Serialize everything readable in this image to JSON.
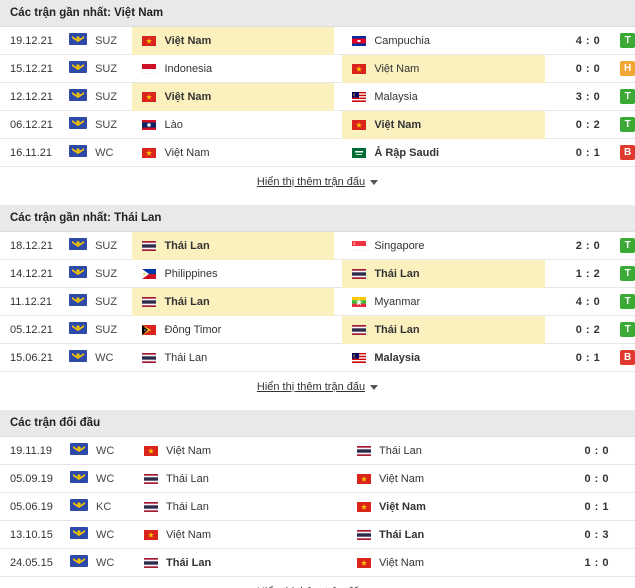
{
  "sections": [
    {
      "title": "Các trận gần nhất: Việt Nam",
      "more_label": "Hiển thị thêm trận đấu",
      "matches": [
        {
          "date": "19.12.21",
          "league": "SUZ",
          "home": {
            "name": "Việt Nam",
            "flag": "vietnam",
            "bold": true,
            "hl": true
          },
          "away": {
            "name": "Campuchia",
            "flag": "cambodia",
            "bold": false,
            "hl": false
          },
          "score": "4 : 0",
          "result": "T"
        },
        {
          "date": "15.12.21",
          "league": "SUZ",
          "home": {
            "name": "Indonesia",
            "flag": "indonesia",
            "bold": false,
            "hl": false
          },
          "away": {
            "name": "Việt Nam",
            "flag": "vietnam",
            "bold": false,
            "hl": true
          },
          "score": "0 : 0",
          "result": "H"
        },
        {
          "date": "12.12.21",
          "league": "SUZ",
          "home": {
            "name": "Việt Nam",
            "flag": "vietnam",
            "bold": true,
            "hl": true
          },
          "away": {
            "name": "Malaysia",
            "flag": "malaysia",
            "bold": false,
            "hl": false
          },
          "score": "3 : 0",
          "result": "T"
        },
        {
          "date": "06.12.21",
          "league": "SUZ",
          "home": {
            "name": "Lào",
            "flag": "laos",
            "bold": false,
            "hl": false
          },
          "away": {
            "name": "Việt Nam",
            "flag": "vietnam",
            "bold": true,
            "hl": true
          },
          "score": "0 : 2",
          "result": "T"
        },
        {
          "date": "16.11.21",
          "league": "WC",
          "home": {
            "name": "Việt Nam",
            "flag": "vietnam",
            "bold": false,
            "hl": false
          },
          "away": {
            "name": "Ả Rập Saudi",
            "flag": "saudi",
            "bold": true,
            "hl": false
          },
          "score": "0 : 1",
          "result": "B"
        }
      ]
    },
    {
      "title": "Các trận gần nhất: Thái Lan",
      "more_label": "Hiển thị thêm trận đấu",
      "matches": [
        {
          "date": "18.12.21",
          "league": "SUZ",
          "home": {
            "name": "Thái Lan",
            "flag": "thailand",
            "bold": true,
            "hl": true
          },
          "away": {
            "name": "Singapore",
            "flag": "singapore",
            "bold": false,
            "hl": false
          },
          "score": "2 : 0",
          "result": "T"
        },
        {
          "date": "14.12.21",
          "league": "SUZ",
          "home": {
            "name": "Philippines",
            "flag": "philippines",
            "bold": false,
            "hl": false
          },
          "away": {
            "name": "Thái Lan",
            "flag": "thailand",
            "bold": true,
            "hl": true
          },
          "score": "1 : 2",
          "result": "T"
        },
        {
          "date": "11.12.21",
          "league": "SUZ",
          "home": {
            "name": "Thái Lan",
            "flag": "thailand",
            "bold": true,
            "hl": true
          },
          "away": {
            "name": "Myanmar",
            "flag": "myanmar",
            "bold": false,
            "hl": false
          },
          "score": "4 : 0",
          "result": "T"
        },
        {
          "date": "05.12.21",
          "league": "SUZ",
          "home": {
            "name": "Đông Timor",
            "flag": "timor",
            "bold": false,
            "hl": false
          },
          "away": {
            "name": "Thái Lan",
            "flag": "thailand",
            "bold": true,
            "hl": true
          },
          "score": "0 : 2",
          "result": "T"
        },
        {
          "date": "15.06.21",
          "league": "WC",
          "home": {
            "name": "Thái Lan",
            "flag": "thailand",
            "bold": false,
            "hl": false
          },
          "away": {
            "name": "Malaysia",
            "flag": "malaysia",
            "bold": true,
            "hl": false
          },
          "score": "0 : 1",
          "result": "B"
        }
      ]
    },
    {
      "title": "Các trận đối đầu",
      "more_label": "Hiển thị thêm trận đấu",
      "matches": [
        {
          "date": "19.11.19",
          "league": "WC",
          "home": {
            "name": "Việt Nam",
            "flag": "vietnam",
            "bold": false,
            "hl": false
          },
          "away": {
            "name": "Thái Lan",
            "flag": "thailand",
            "bold": false,
            "hl": false
          },
          "score": "0 : 0",
          "result": ""
        },
        {
          "date": "05.09.19",
          "league": "WC",
          "home": {
            "name": "Thái Lan",
            "flag": "thailand",
            "bold": false,
            "hl": false
          },
          "away": {
            "name": "Việt Nam",
            "flag": "vietnam",
            "bold": false,
            "hl": false
          },
          "score": "0 : 0",
          "result": ""
        },
        {
          "date": "05.06.19",
          "league": "KC",
          "home": {
            "name": "Thái Lan",
            "flag": "thailand",
            "bold": false,
            "hl": false
          },
          "away": {
            "name": "Việt Nam",
            "flag": "vietnam",
            "bold": true,
            "hl": false
          },
          "score": "0 : 1",
          "result": ""
        },
        {
          "date": "13.10.15",
          "league": "WC",
          "home": {
            "name": "Việt Nam",
            "flag": "vietnam",
            "bold": false,
            "hl": false
          },
          "away": {
            "name": "Thái Lan",
            "flag": "thailand",
            "bold": true,
            "hl": false
          },
          "score": "0 : 3",
          "result": ""
        },
        {
          "date": "24.05.15",
          "league": "WC",
          "home": {
            "name": "Thái Lan",
            "flag": "thailand",
            "bold": true,
            "hl": false
          },
          "away": {
            "name": "Việt Nam",
            "flag": "vietnam",
            "bold": false,
            "hl": false
          },
          "score": "1 : 0",
          "result": ""
        }
      ]
    }
  ],
  "league_icon": "league-logo-icon",
  "colors": {
    "win": "#3aaa35",
    "draw": "#f2a735",
    "loss": "#e03a2f",
    "highlight": "#fbf1bf",
    "header_bg": "#e9e9e9"
  }
}
